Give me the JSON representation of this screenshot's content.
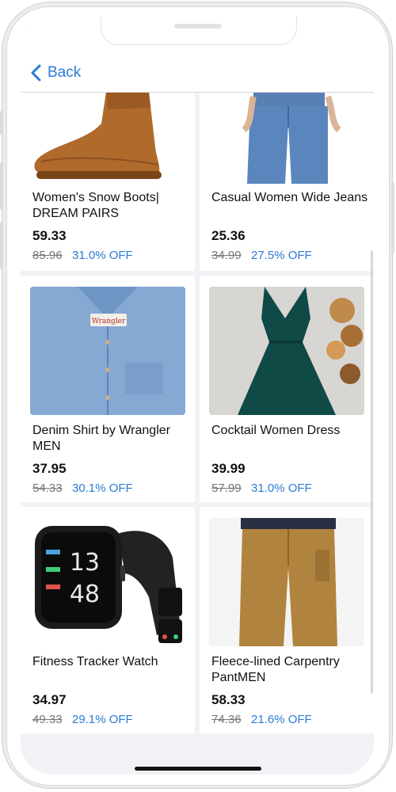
{
  "nav": {
    "back_label": "Back"
  },
  "products": [
    {
      "name": "Women's Snow Boots| DREAM PAIRS",
      "price": "59.33",
      "original_price": "85.96",
      "discount": "31.0% OFF"
    },
    {
      "name": "Casual Women Wide Jeans",
      "price": "25.36",
      "original_price": "34.99",
      "discount": "27.5% OFF"
    },
    {
      "name": "Denim Shirt by Wrangler MEN",
      "price": "37.95",
      "original_price": "54.33",
      "discount": "30.1% OFF",
      "label_text": "Wrangler"
    },
    {
      "name": "Cocktail Women Dress",
      "price": "39.99",
      "original_price": "57.99",
      "discount": "31.0% OFF"
    },
    {
      "name": "Fitness Tracker Watch",
      "price": "34.97",
      "original_price": "49.33",
      "discount": "29.1% OFF",
      "watch_time_hours": "13",
      "watch_time_minutes": "48"
    },
    {
      "name": "Fleece-lined Carpentry PantMEN",
      "price": "58.33",
      "original_price": "74.36",
      "discount": "21.6% OFF"
    }
  ],
  "colors": {
    "accent": "#2a7bd5",
    "background": "#f2f2f6"
  }
}
